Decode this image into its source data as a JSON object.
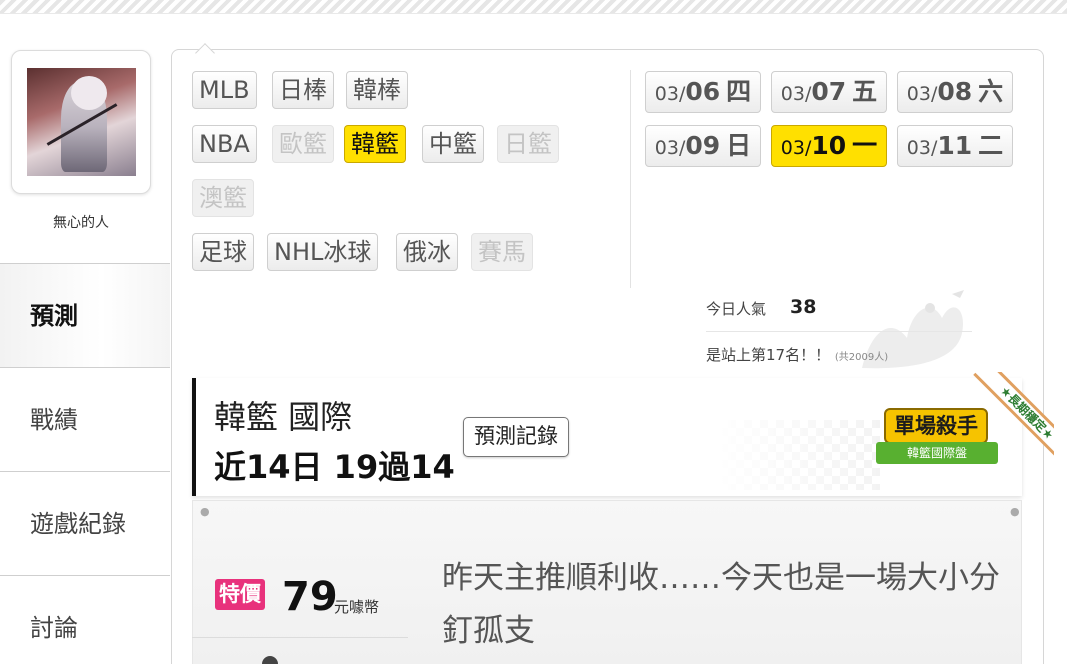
{
  "user": {
    "name": "無心的人"
  },
  "nav": [
    {
      "label": "預測",
      "active": true
    },
    {
      "label": "戰績"
    },
    {
      "label": "遊戲紀錄"
    },
    {
      "label": "討論"
    }
  ],
  "leagues": {
    "mlb": "MLB",
    "npb": "日棒",
    "kbo": "韓棒",
    "nba": "NBA",
    "euro": "歐籃",
    "kbl": "韓籃",
    "cba": "中籃",
    "jpb": "日籃",
    "nbl": "澳籃",
    "soccer": "足球",
    "nhl": "NHL冰球",
    "khl": "俄冰",
    "horse": "賽馬"
  },
  "dates": [
    {
      "md": "03/",
      "day": "06",
      "wd": "四"
    },
    {
      "md": "03/",
      "day": "07",
      "wd": "五"
    },
    {
      "md": "03/",
      "day": "08",
      "wd": "六"
    },
    {
      "md": "03/",
      "day": "09",
      "wd": "日"
    },
    {
      "md": "03/",
      "day": "10",
      "wd": "一",
      "selected": true
    },
    {
      "md": "03/",
      "day": "11",
      "wd": "二"
    }
  ],
  "popularity": {
    "label": "今日人氣",
    "count": "38",
    "rank_text": "是站上第17名！！",
    "total": "(共2009人)"
  },
  "header": {
    "league": "韓籃 國際",
    "record": "近14日 19過14",
    "history_button": "預測記錄"
  },
  "badge": {
    "title": "單場殺手",
    "subtitle": "韓籃國際盤",
    "ribbon": "★長期穩定★"
  },
  "offer": {
    "tag": "特價",
    "price": "79",
    "unit": "元噱幣",
    "description": "昨天主推順利收……今天也是一場大小分釘孤支"
  },
  "colors": {
    "selected": "#ffe000",
    "price_tag": "#e8327c",
    "badge_gold": "#f6c300",
    "badge_green": "#58b030"
  }
}
